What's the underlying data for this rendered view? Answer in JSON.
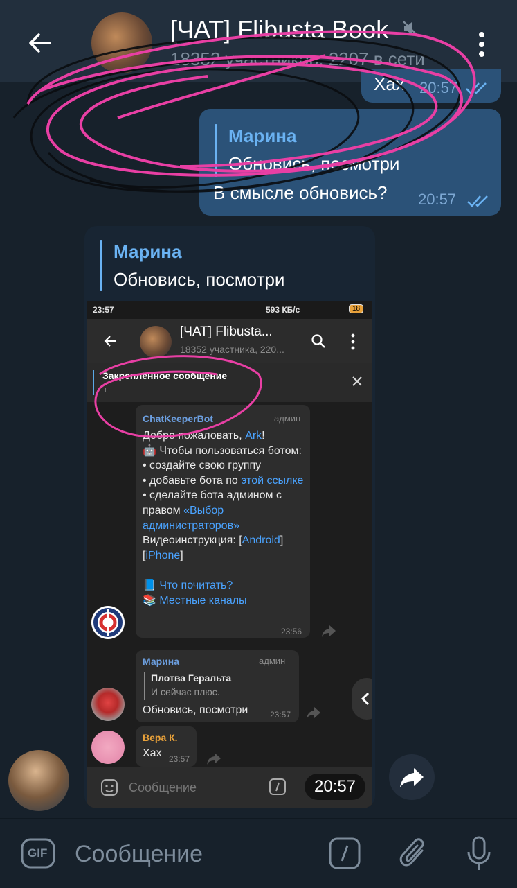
{
  "header": {
    "title": "[ЧАТ] Flibusta Book",
    "subtitle": "18352 участников, 2207 в сети"
  },
  "messages_out": [
    {
      "text": "Хах",
      "time": "20:57"
    },
    {
      "reply_name": "Марина",
      "reply_text": "Обновись, посмотри",
      "text": "В смысле обновись?",
      "time": "20:57"
    }
  ],
  "message_in": {
    "reply_name": "Марина",
    "reply_text": "Обновись, посмотри",
    "time": "20:57"
  },
  "screenshot": {
    "status_time": "23:57",
    "status_right": "593 КБ/с",
    "battery": "18",
    "title": "[ЧАТ] Flibusta...",
    "subtitle": "18352 участника, 220...",
    "pinned_title": "Закреплённое сообщение",
    "pinned_preview": "+",
    "msg1": {
      "name": "ChatKeeperBot",
      "role": "админ",
      "greeting_prefix": "Добро пожаловать, ",
      "greeting_link": "Ark",
      "greeting_suffix": "!",
      "line2": "🤖 Чтобы пользоваться ботом:",
      "line3": "• создайте свою группу",
      "line4_prefix": "• добавьте бота по ",
      "line4_link": "этой ссылке",
      "line5_prefix": "• сделайте бота админом с правом ",
      "line5_link": "«Выбор администраторов»",
      "line6_prefix": "Видеоинструкция: [",
      "line6_link1": "Android",
      "line6_mid": "] [",
      "line6_link2": "iPhone",
      "line6_suffix": "]",
      "link_what": "📘 Что почитать?",
      "link_channels": "📚 Местные каналы",
      "time": "23:56"
    },
    "msg2": {
      "name": "Марина",
      "role": "админ",
      "quote_name": "Плотва Геральта",
      "quote_text": "И сейчас плюс.",
      "text": "Обновись, посмотри",
      "time": "23:57"
    },
    "msg3": {
      "name": "Вера К.",
      "text": "Хах",
      "time": "23:57"
    },
    "input_placeholder": "Сообщение"
  },
  "composer": {
    "gif_label": "GIF",
    "placeholder": "Сообщение"
  },
  "icons": [
    "back-arrow-icon",
    "mute-icon",
    "more-vertical-icon",
    "read-ticks-icon",
    "share-icon",
    "gif-icon",
    "command-icon",
    "attach-icon",
    "mic-icon",
    "forward-icon"
  ],
  "colors": {
    "header_bg": "#222f3d",
    "chat_bg": "#17212b",
    "bubble_out": "#2b5278",
    "bubble_in": "#182533",
    "accent": "#6ab2f2",
    "annotation": "#e83fa4"
  }
}
